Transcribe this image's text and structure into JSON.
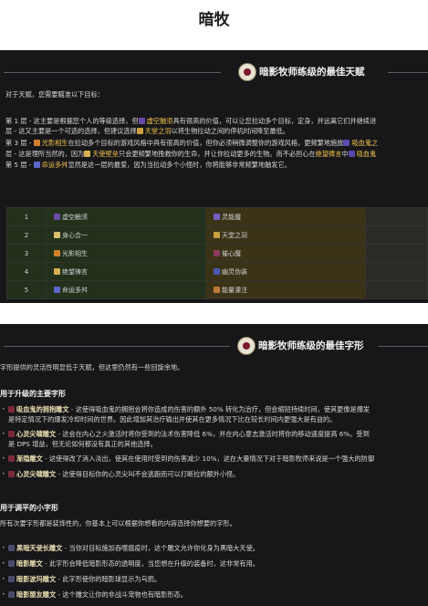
{
  "page_title": "暗牧",
  "talents": {
    "header": "暗影牧师练级的最佳天赋",
    "intro": "对于天赋，您需要瞄准以下目标：",
    "row1": {
      "pre": "第 1 层 - 这主要是根据您个人的等级选择，但",
      "t1": "虚空触须",
      "post": "具有很高的价值，可以让您拉动多个目标，定身，并远离它们并继续进"
    },
    "row2": {
      "pre": "层 - 这又主要是一个可选的选择，但建议选择",
      "t1": "天堂之羽",
      "post": "以将生物拉动之间的停机时间降至最低。"
    },
    "row3": {
      "pre": "第 3 层 - ",
      "t1": "光影相生",
      "mid": "在拉动多个目标的游戏风格中具有很高的价值，但你必须稍微调整你的游戏风格，更频繁地施放",
      "t2": "吸血鬼之"
    },
    "row4": {
      "pre": "层 - 这是理所当然的，因为",
      "t1": "天使壁垒",
      "mid": "只会更频繁地挽救你的生命，并让你拉动更多的生物。而不必担心在",
      "t2": "绝望祷言",
      "post": "中",
      "t3": "吸血鬼"
    },
    "row5": {
      "pre": "第 5 层 - ",
      "t1": "命运多舛",
      "post": "显然是这一层的最爱，因为当拉动多个小怪时，你将能够非常频繁地触发它。"
    },
    "table": [
      {
        "level": "1",
        "a": "虚空触须",
        "b": "灵能魔"
      },
      {
        "level": "2",
        "a": "身心合一",
        "b": "天堂之羽"
      },
      {
        "level": "3",
        "a": "光影相生",
        "b": "催心魔"
      },
      {
        "level": "4",
        "a": "绝望祷言",
        "b": "幽灵伪装"
      },
      {
        "level": "5",
        "a": "命运多舛",
        "b": "能量灌注"
      }
    ]
  },
  "glyphs": {
    "header": "暗影牧师练级的最佳字形",
    "intro": "字形提供的灵活性明显低于天赋，但这里仍然有一些回旋余地。",
    "major_title": "用于升级的主要字形",
    "major": [
      {
        "name": "吸血鬼的拥抱雕文",
        "desc": "- 这使得吸血鬼的拥抱会将你造成的伤害的额外 50% 转化为治疗，但会缩短持续时间，使其更像是爆发",
        "desc2": "是特定情况下的爆发冷却时间的世界。因此增加其治疗输出并使其在更多情况下比在较长时间内更强大是有益的。"
      },
      {
        "name": "心灵尖啸雕文",
        "desc": "- 这会在内心之火激活时将你受到的法术伤害降低 6%，并在内心意志激活时将你的移动速度提高 6%。受到",
        "desc2": "是 DPS 增益，但无论如何都没有真正的其他选择。"
      },
      {
        "name": "渐隐雕文",
        "desc": "- 这使得改了消入淡出，使其在使用时受到的伤害减少 10%，这在大量情况下对于暗影牧师来说是一个强大的防御"
      },
      {
        "name": "心灵尖啸雕文",
        "desc": "- 这使得目标你的心灵尖叫不会逃跑而可以打断拉的额外小怪。"
      }
    ],
    "minor_title": "用于调平的小字形",
    "minor_intro": "所有次要字形都是装饰性的，你基本上可以根据你想看的内容选择你想要的字形。",
    "minor": [
      {
        "name": "黑暗天使长雕文",
        "desc": "- 当你对目标施加吞噬瘟疫时，这个雕文允许你化身为黑暗大天使。"
      },
      {
        "name": "暗影雕文",
        "desc": "- 此字形会降低暗影形态的透明度，当您想在升级的装备时，这非常有用。"
      },
      {
        "name": "暗影波玛雕文",
        "desc": "- 此字形使你的暗影球显示为乌鸦。"
      },
      {
        "name": "暗影盟友雕文",
        "desc": "- 这个雕文让你的非战斗宠物也有暗影形态。"
      }
    ]
  },
  "colors": {
    "row_a": "#23301c",
    "row_b": "#3a3318",
    "highlight": "#f2c24c"
  }
}
